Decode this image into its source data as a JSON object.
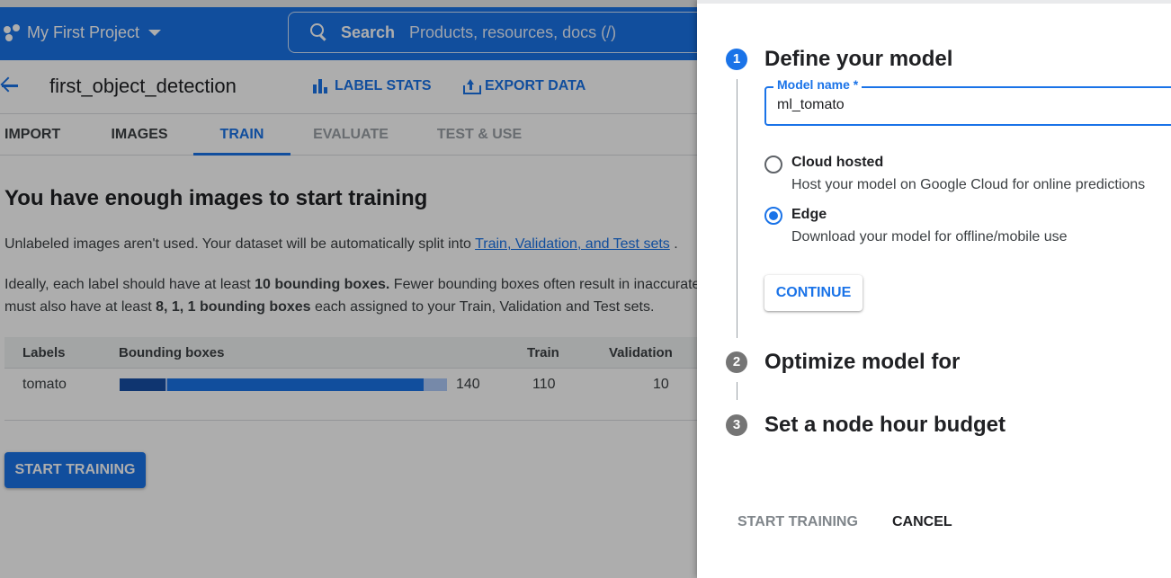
{
  "header": {
    "project": "My First Project",
    "search_label": "Search",
    "search_placeholder": "Products, resources, docs (/)"
  },
  "dataset": {
    "name": "first_object_detection",
    "label_stats": "LABEL STATS",
    "export_data": "EXPORT DATA"
  },
  "tabs": [
    {
      "label": "IMPORT",
      "state": "normal"
    },
    {
      "label": "IMAGES",
      "state": "normal"
    },
    {
      "label": "TRAIN",
      "state": "active"
    },
    {
      "label": "EVALUATE",
      "state": "disabled"
    },
    {
      "label": "TEST & USE",
      "state": "disabled"
    }
  ],
  "train": {
    "heading": "You have enough images to start training",
    "p1_text": "Unlabeled images aren't used. Your dataset will be automatically split into ",
    "p1_link": "Train, Validation, and Test sets",
    "p1_end": " .",
    "p2_a": "Ideally, each label should have at least ",
    "p2_b": "10 bounding boxes.",
    "p2_c": " Fewer bounding boxes often result in inaccurate",
    "p3_a": "must also have at least ",
    "p3_b": "8, 1, 1 bounding boxes",
    "p3_c": " each assigned to your Train, Validation and Test sets.",
    "table": {
      "headers": [
        "Labels",
        "Bounding boxes",
        "Train",
        "Validation"
      ],
      "rows": [
        {
          "label": "tomato",
          "boxes": "140",
          "train": "110",
          "validation": "10"
        }
      ]
    },
    "start_button": "START TRAINING"
  },
  "panel": {
    "steps": [
      {
        "num": "1",
        "title": "Define your model",
        "state": "active"
      },
      {
        "num": "2",
        "title": "Optimize model for",
        "state": "pending"
      },
      {
        "num": "3",
        "title": "Set a node hour budget",
        "state": "pending"
      }
    ],
    "model_name_label": "Model name *",
    "model_name_value": "ml_tomato",
    "options": [
      {
        "title": "Cloud hosted",
        "desc": "Host your model on Google Cloud for online predictions",
        "checked": false
      },
      {
        "title": "Edge",
        "desc": "Download your model for offline/mobile use",
        "checked": true
      }
    ],
    "continue": "CONTINUE",
    "start_training": "START TRAINING",
    "cancel": "CANCEL"
  },
  "colors": {
    "primary": "#1a73e8",
    "bar_dark": "#174ea6",
    "bar_mid": "#1a73e8",
    "bar_light": "#aecbfa"
  }
}
